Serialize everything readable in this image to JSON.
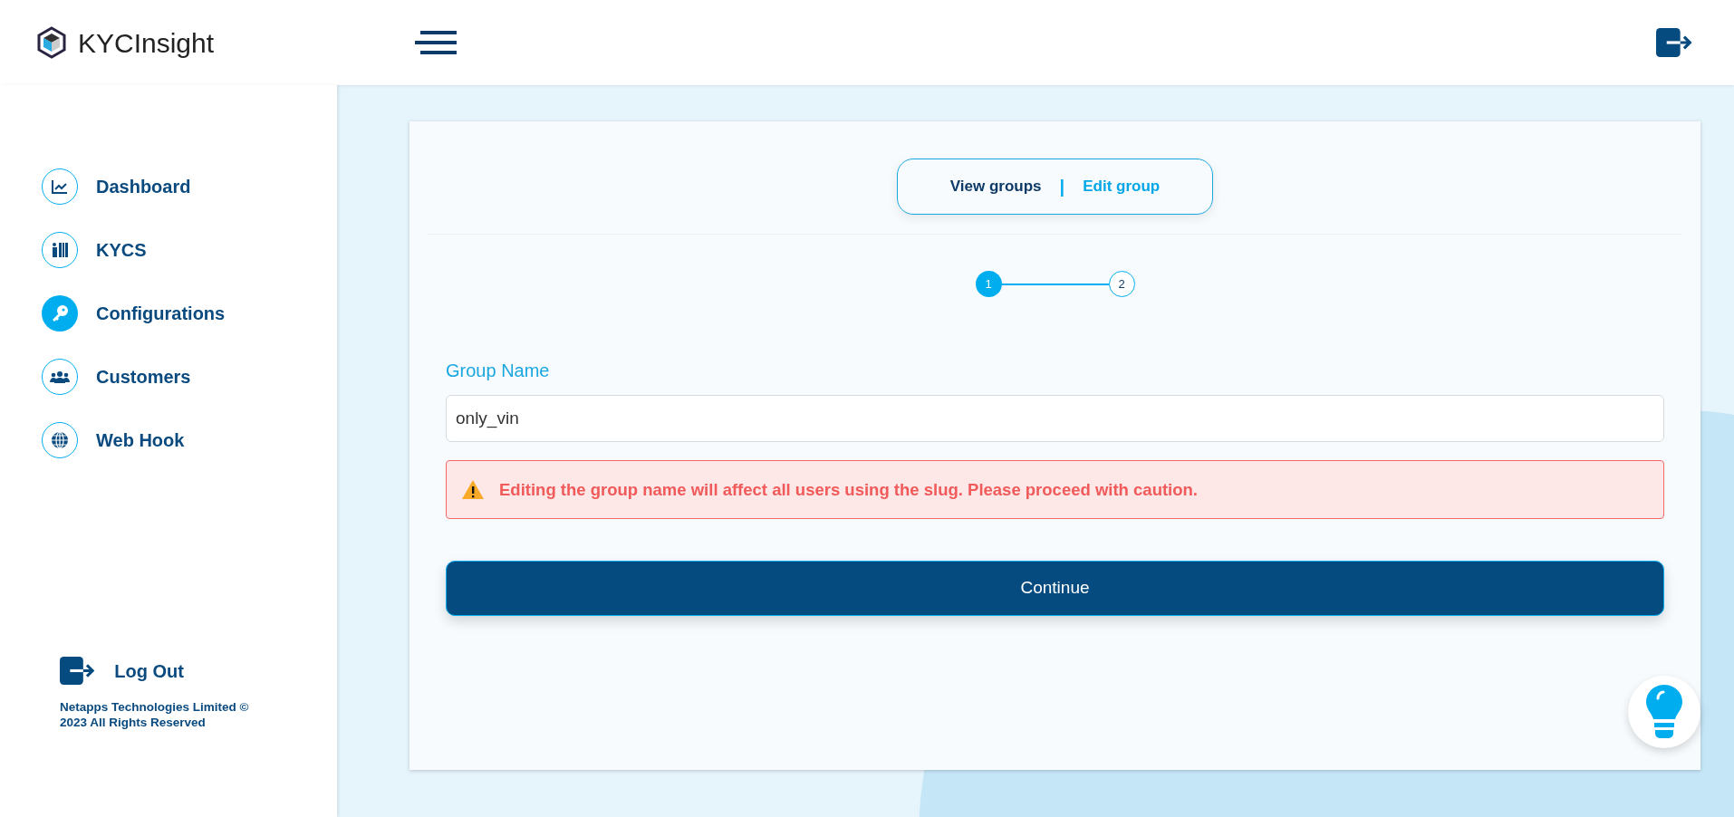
{
  "brand": {
    "name": "KYCInsight"
  },
  "sidebar": {
    "items": [
      {
        "label": "Dashboard",
        "selected": false
      },
      {
        "label": "KYCS",
        "selected": false
      },
      {
        "label": "Configurations",
        "selected": true
      },
      {
        "label": "Customers",
        "selected": false
      },
      {
        "label": "Web Hook",
        "selected": false
      }
    ],
    "logout": "Log Out",
    "footer": "Netapps Technologies Limited © 2023 All Rights Reserved"
  },
  "tabs": [
    {
      "label": "View groups",
      "selected": false
    },
    {
      "label": "Edit group",
      "selected": true
    }
  ],
  "tab_separator": "|",
  "steps": [
    {
      "label": "1",
      "selected": true
    },
    {
      "label": "2",
      "selected": false
    }
  ],
  "form": {
    "label": "Group Name",
    "value": "only_vin",
    "warning": "Editing the group name will affect all users using the slug. Please proceed with caution.",
    "button": "Continue"
  }
}
